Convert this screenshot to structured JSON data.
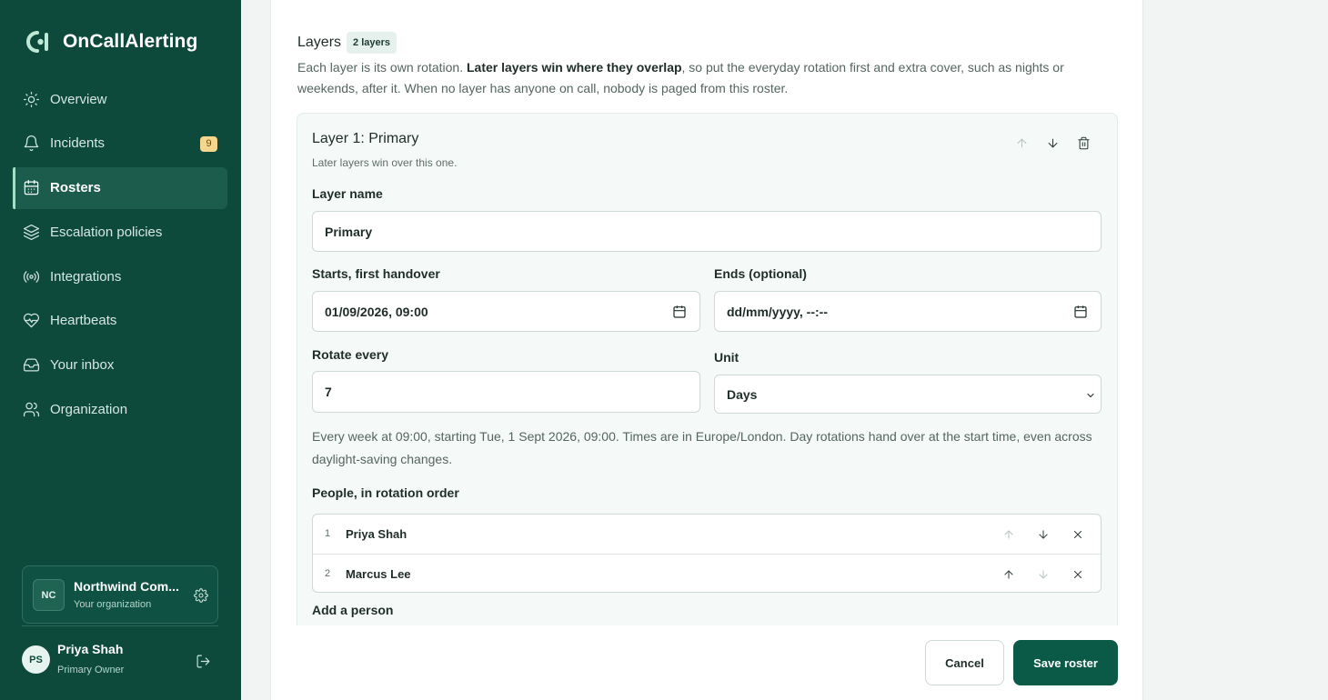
{
  "app": {
    "name": "OnCallAlerting"
  },
  "sidebar": {
    "items": [
      {
        "label": "Overview",
        "icon": "sun-icon"
      },
      {
        "label": "Incidents",
        "icon": "bell-icon",
        "badge": "9"
      },
      {
        "label": "Rosters",
        "icon": "calendar-icon",
        "active": true
      },
      {
        "label": "Escalation policies",
        "icon": "layers-icon"
      },
      {
        "label": "Integrations",
        "icon": "broadcast-icon"
      },
      {
        "label": "Heartbeats",
        "icon": "heart-pulse-icon"
      },
      {
        "label": "Your inbox",
        "icon": "inbox-icon"
      },
      {
        "label": "Organization",
        "icon": "users-icon"
      }
    ],
    "org": {
      "initials": "NC",
      "name": "Northwind Com...",
      "subtitle": "Your organization"
    },
    "user": {
      "initials": "PS",
      "name": "Priya Shah",
      "role": "Primary Owner"
    }
  },
  "layers": {
    "title": "Layers",
    "count_label": "2 layers",
    "intro_pre": "Each layer is its own rotation. ",
    "intro_bold": "Later layers win where they overlap",
    "intro_post": ", so put the everyday rotation first and extra cover, such as nights or weekends, after it. When no layer has anyone on call, nobody is paged from this roster."
  },
  "layer": {
    "heading": "Layer 1: Primary",
    "subheading": "Later layers win over this one.",
    "name_label": "Layer name",
    "name_value": "Primary",
    "starts_label": "Starts, first handover",
    "starts_value": "01/09/2026, 09:00",
    "ends_label": "Ends (optional)",
    "ends_value": "dd/mm/yyyy, --:--",
    "rotate_label": "Rotate every",
    "rotate_value": "7",
    "unit_label": "Unit",
    "unit_value": "Days",
    "summary": "Every week at 09:00, starting Tue, 1 Sept 2026, 09:00. Times are in Europe/London. Day rotations hand over at the start time, even across daylight-saving changes.",
    "people_label": "People, in rotation order",
    "people": [
      {
        "order": "1",
        "name": "Priya Shah"
      },
      {
        "order": "2",
        "name": "Marcus Lee"
      }
    ],
    "add_person_label": "Add a person"
  },
  "footer": {
    "cancel_label": "Cancel",
    "save_label": "Save roster"
  },
  "colors": {
    "sidebar_bg": "#0d4a3c",
    "accent": "#0b5a48",
    "badge_bg": "#f6d58c"
  }
}
